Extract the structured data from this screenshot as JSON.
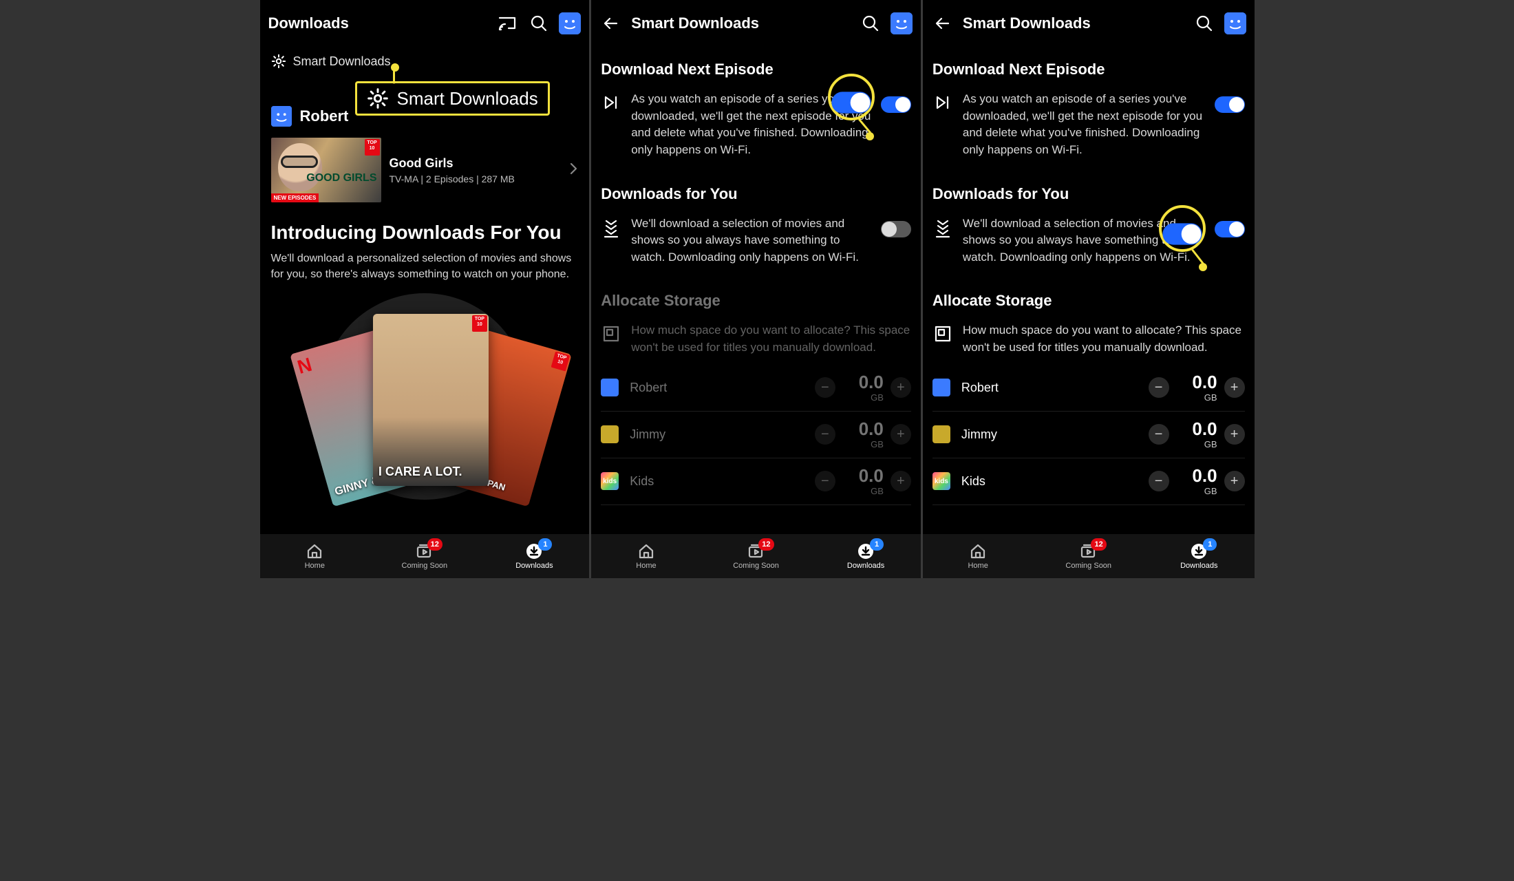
{
  "pane1": {
    "title": "Downloads",
    "smart_link": "Smart Downloads",
    "callout_label": "Smart Downloads",
    "profile_name": "Robert",
    "download": {
      "title": "Good Girls",
      "subtitle": "TV-MA | 2 Episodes | 287 MB",
      "badge_top10": "TOP 10",
      "badge_new": "NEW EPISODES",
      "thumb_logo": "GOOD GIRLS"
    },
    "intro_heading": "Introducing Downloads For You",
    "intro_body": "We'll download a personalized selection of movies and shows for you, so there's always something to watch on your phone.",
    "cards": {
      "left": "GINNY & GEO…",
      "center": "I CARE A LOT.",
      "right": "…MURAI JAPAN",
      "top10": "TOP 10"
    }
  },
  "pane2": {
    "title": "Smart Downloads",
    "download_next": {
      "heading": "Download Next Episode",
      "body": "As you watch an episode of a series you've downloaded, we'll get the next episode for you and delete what you've finished. Downloading only happens on Wi-Fi."
    },
    "downloads_for_you": {
      "heading": "Downloads for You",
      "body": "We'll download a selection of movies and shows so you always have something to watch. Downloading only happens on Wi-Fi."
    },
    "allocate": {
      "heading": "Allocate Storage",
      "body": "How much space do you want to allocate? This space won't be used for titles you manually download."
    },
    "unit": "GB",
    "users": [
      {
        "name": "Robert",
        "value": "0.0",
        "pf": "pf-blue"
      },
      {
        "name": "Jimmy",
        "value": "0.0",
        "pf": "pf-yellow"
      },
      {
        "name": "Kids",
        "value": "0.0",
        "pf": "pf-rainbow",
        "kids": true
      }
    ]
  },
  "pane3": {
    "title": "Smart Downloads",
    "download_next": {
      "heading": "Download Next Episode",
      "body": "As you watch an episode of a series you've downloaded, we'll get the next episode for you and delete what you've finished. Downloading only happens on Wi-Fi."
    },
    "downloads_for_you": {
      "heading": "Downloads for You",
      "body": "We'll download a selection of movies and shows so you always have something to watch. Downloading only happens on Wi-Fi."
    },
    "allocate": {
      "heading": "Allocate Storage",
      "body": "How much space do you want to allocate? This space won't be used for titles you manually download."
    },
    "unit": "GB",
    "users": [
      {
        "name": "Robert",
        "value": "0.0",
        "pf": "pf-blue"
      },
      {
        "name": "Jimmy",
        "value": "0.0",
        "pf": "pf-yellow"
      },
      {
        "name": "Kids",
        "value": "0.0",
        "pf": "pf-rainbow",
        "kids": true
      }
    ]
  },
  "nav": {
    "home": "Home",
    "coming": "Coming Soon",
    "downloads": "Downloads",
    "coming_badge": "12",
    "downloads_badge": "1"
  }
}
